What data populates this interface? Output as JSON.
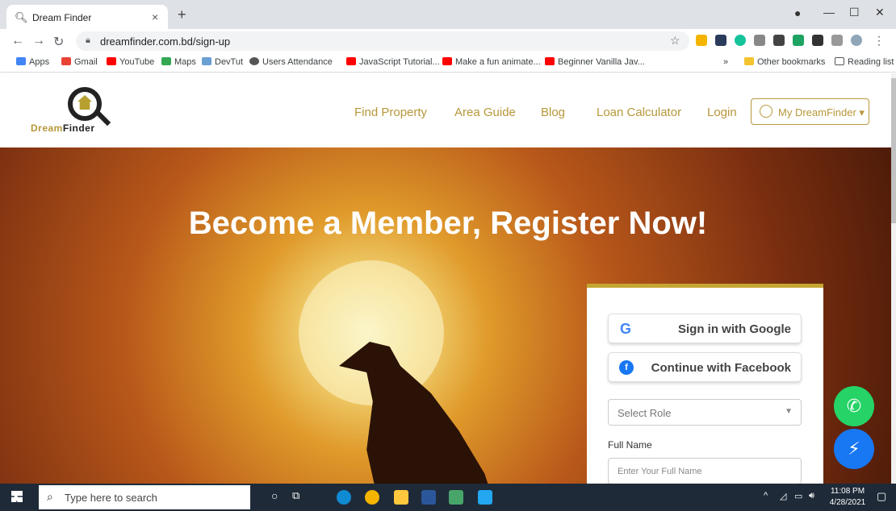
{
  "browser": {
    "tab_title": "Dream Finder",
    "tab_close": "×",
    "new_tab": "+",
    "url": "dreamfinder.com.bd/sign-up",
    "window_controls": [
      "—",
      "☐",
      "✕"
    ]
  },
  "bookmarks": {
    "items": [
      {
        "label": "Apps",
        "color": "#4285f4"
      },
      {
        "label": "Gmail",
        "color": "#ea4335"
      },
      {
        "label": "YouTube",
        "color": "#ff0000"
      },
      {
        "label": "Maps",
        "color": "#34a853"
      },
      {
        "label": "DevTut",
        "color": "#6a9fd4"
      },
      {
        "label": "Users Attendance",
        "color": "#555555"
      },
      {
        "label": "JavaScript Tutorial...",
        "color": "#ff0000"
      },
      {
        "label": "Make a fun animate...",
        "color": "#ff0000"
      },
      {
        "label": "Beginner Vanilla Jav...",
        "color": "#ff0000"
      }
    ],
    "overflow": "»",
    "other": "Other bookmarks",
    "reading": "Reading list"
  },
  "site": {
    "logo_word_a": "Dream",
    "logo_word_b": "Finder",
    "nav": [
      "Find Property",
      "Area Guide",
      "Blog",
      "Loan Calculator",
      "Login"
    ],
    "account_button": "My DreamFinder",
    "account_caret": "▾",
    "accent": "#b8973a"
  },
  "hero": {
    "title": "Become a Member, Register Now!"
  },
  "signup_card": {
    "google_label": "Sign in with Google",
    "facebook_label": "Continue with Facebook",
    "role_select": "Select Role",
    "full_name_label": "Full Name",
    "full_name_placeholder": "Enter Your Full Name"
  },
  "floating": {
    "whatsapp_color": "#25d366",
    "messenger_color": "#1877f2"
  },
  "taskbar": {
    "search_placeholder": "Type here to search",
    "time": "11:08 PM",
    "date": "4/28/2021"
  }
}
